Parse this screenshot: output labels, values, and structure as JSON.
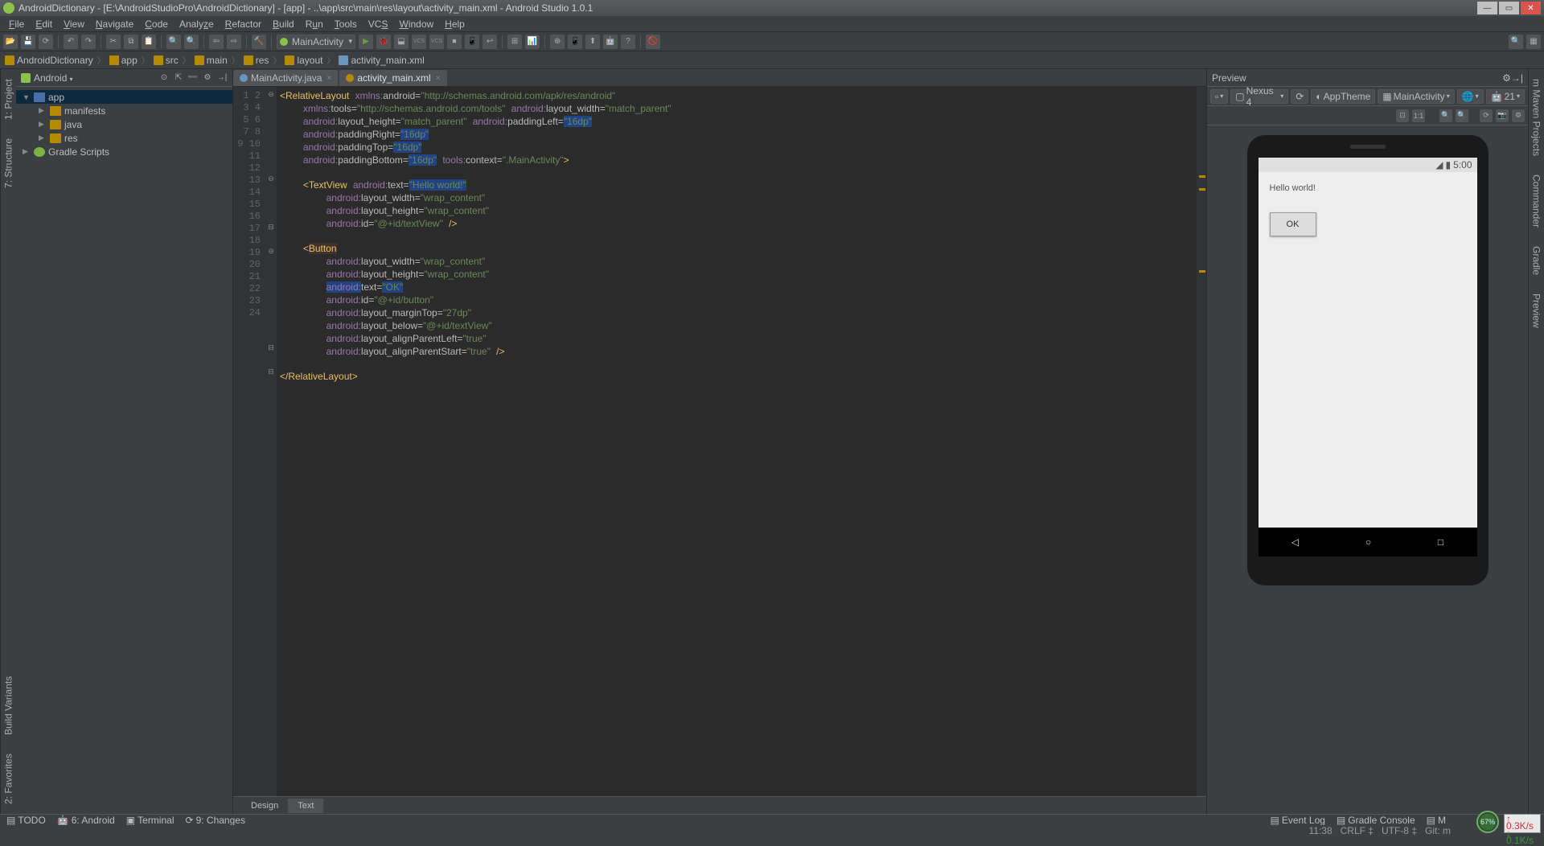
{
  "window": {
    "title": "AndroidDictionary - [E:\\AndroidStudioPro\\AndroidDictionary] - [app] - ..\\app\\src\\main\\res\\layout\\activity_main.xml - Android Studio 1.0.1"
  },
  "menu": [
    "File",
    "Edit",
    "View",
    "Navigate",
    "Code",
    "Analyze",
    "Refactor",
    "Build",
    "Run",
    "Tools",
    "VCS",
    "Window",
    "Help"
  ],
  "toolbar": {
    "config": "MainActivity"
  },
  "breadcrumb": [
    "AndroidDictionary",
    "app",
    "src",
    "main",
    "res",
    "layout",
    "activity_main.xml"
  ],
  "project": {
    "viewMode": "Android",
    "tree": {
      "root": "app",
      "children": [
        "manifests",
        "java",
        "res"
      ],
      "gradle": "Gradle Scripts"
    }
  },
  "tabs": [
    {
      "name": "MainActivity.java",
      "active": false
    },
    {
      "name": "activity_main.xml",
      "active": true
    }
  ],
  "code": {
    "lines": 24
  },
  "editorTabs": {
    "design": "Design",
    "text": "Text"
  },
  "preview": {
    "title": "Preview",
    "device": "Nexus 4",
    "theme": "AppTheme",
    "activity": "MainActivity",
    "api": "21",
    "statusTime": "5:00",
    "helloText": "Hello world!",
    "buttonText": "OK"
  },
  "leftTabs": [
    "1: Project",
    "7: Structure"
  ],
  "rightTabs": [
    "m Maven Projects",
    "Commander",
    "Gradle",
    "Preview"
  ],
  "bottomLeftTabs": [
    "Build Variants",
    "2: Favorites"
  ],
  "statusbar": {
    "todo": "TODO",
    "android": "6: Android",
    "terminal": "Terminal",
    "changes": "9: Changes",
    "eventLog": "Event Log",
    "gradleConsole": "Gradle Console",
    "memory": "M"
  },
  "info": {
    "pos": "11:38",
    "sep": "CRLF",
    "enc": "UTF-8",
    "git": "Git: m",
    "mem": "67%",
    "up": "0.3K/s",
    "down": "0.1K/s"
  }
}
